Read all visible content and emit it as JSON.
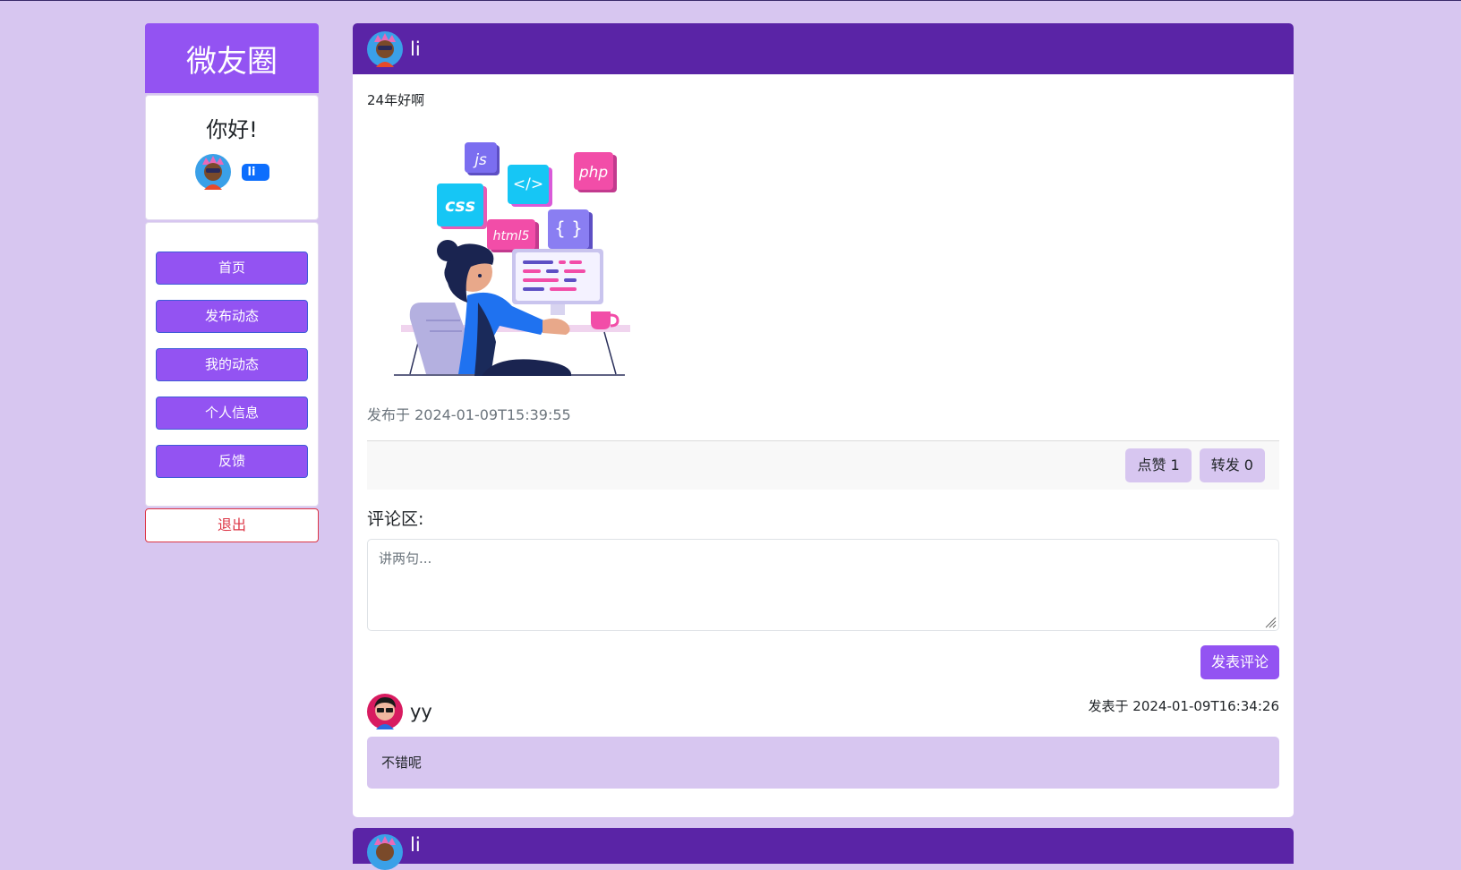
{
  "app": {
    "brand": "微友圈"
  },
  "greeting": {
    "title": "你好!",
    "username": "li"
  },
  "nav": {
    "items": [
      {
        "label": "首页"
      },
      {
        "label": "发布动态"
      },
      {
        "label": "我的动态"
      },
      {
        "label": "个人信息"
      },
      {
        "label": "反馈"
      }
    ],
    "logout": "退出"
  },
  "post": {
    "author": "li",
    "text": "24年好啊",
    "image_labels": {
      "js": "js",
      "code": "</>",
      "php": "php",
      "css": "css",
      "html5": "html5",
      "braces": "{ }"
    },
    "time": "发布于 2024-01-09T15:39:55",
    "like_label": "点赞 1",
    "share_label": "转发 0",
    "comment_title": "评论区:",
    "comment_placeholder": "讲两句...",
    "submit_label": "发表评论",
    "comments": [
      {
        "author": "yy",
        "time": "发表于 2024-01-09T16:34:26",
        "text": "不错呢"
      }
    ]
  },
  "next_post": {
    "author": "li"
  },
  "colors": {
    "background": "#d7c6f0",
    "accent": "#9353f2",
    "header": "#5a24a6",
    "danger": "#dc3545",
    "badge": "#0d6efd"
  }
}
